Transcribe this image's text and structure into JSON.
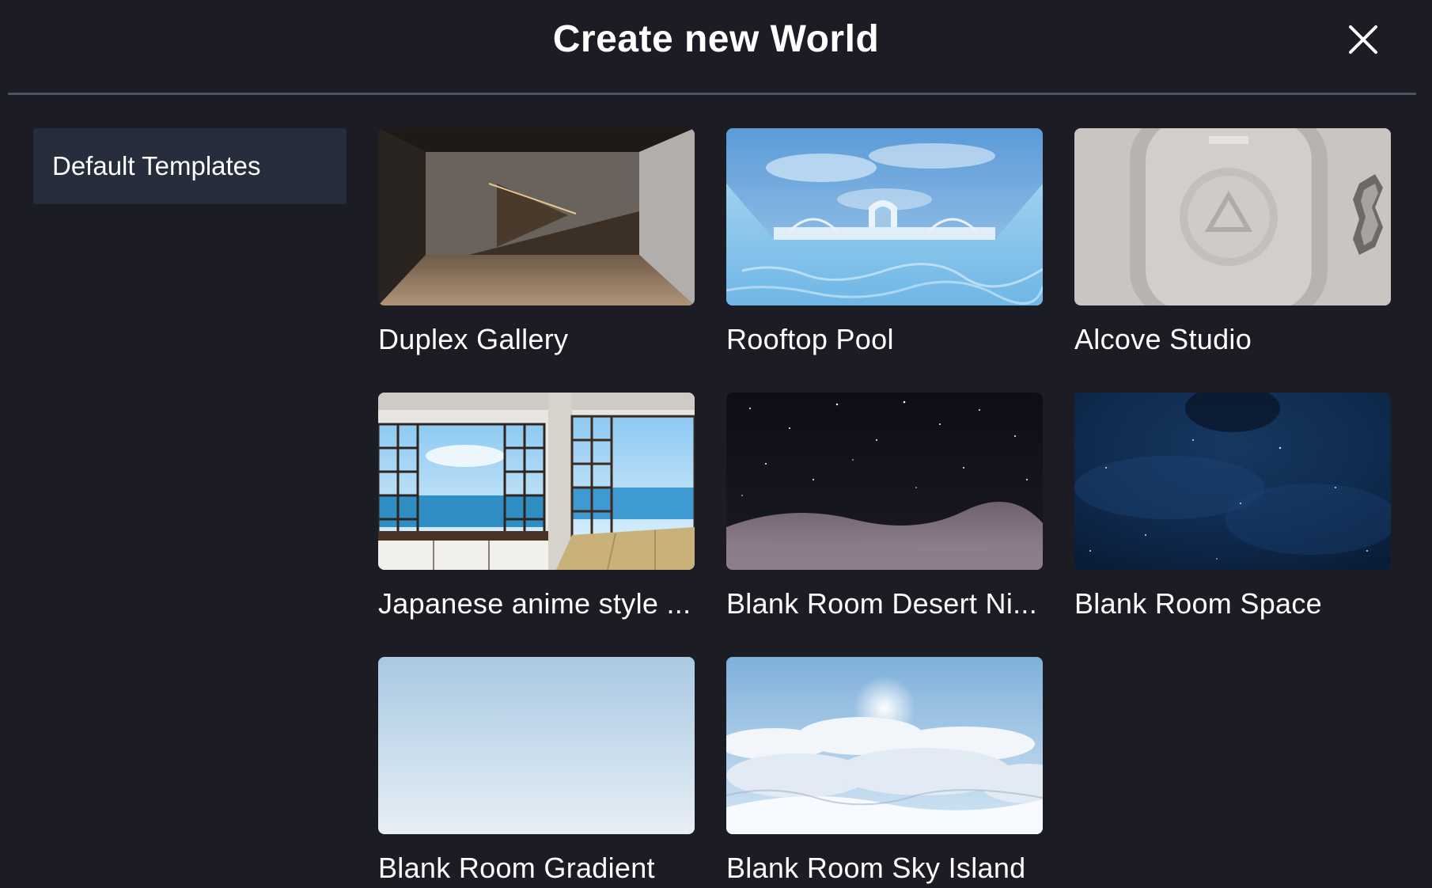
{
  "header": {
    "title": "Create new World",
    "close_icon": "close-icon"
  },
  "sidebar": {
    "items": [
      {
        "label": "Default Templates",
        "selected": true
      }
    ]
  },
  "templates": [
    {
      "label": "Duplex Gallery",
      "thumbnail": "gallery-interior"
    },
    {
      "label": "Rooftop Pool",
      "thumbnail": "rooftop-pool"
    },
    {
      "label": "Alcove Studio",
      "thumbnail": "alcove-studio"
    },
    {
      "label": "Japanese anime style ...",
      "thumbnail": "japanese-room"
    },
    {
      "label": "Blank Room Desert Ni...",
      "thumbnail": "desert-night"
    },
    {
      "label": "Blank Room Space",
      "thumbnail": "space"
    },
    {
      "label": "Blank Room Gradient",
      "thumbnail": "sky-gradient"
    },
    {
      "label": "Blank Room Sky Island",
      "thumbnail": "sky-island"
    }
  ],
  "colors": {
    "background": "#1c1d24",
    "sidebar_selected": "#262d3c",
    "divider": "#4a5466",
    "text": "#ffffff"
  }
}
